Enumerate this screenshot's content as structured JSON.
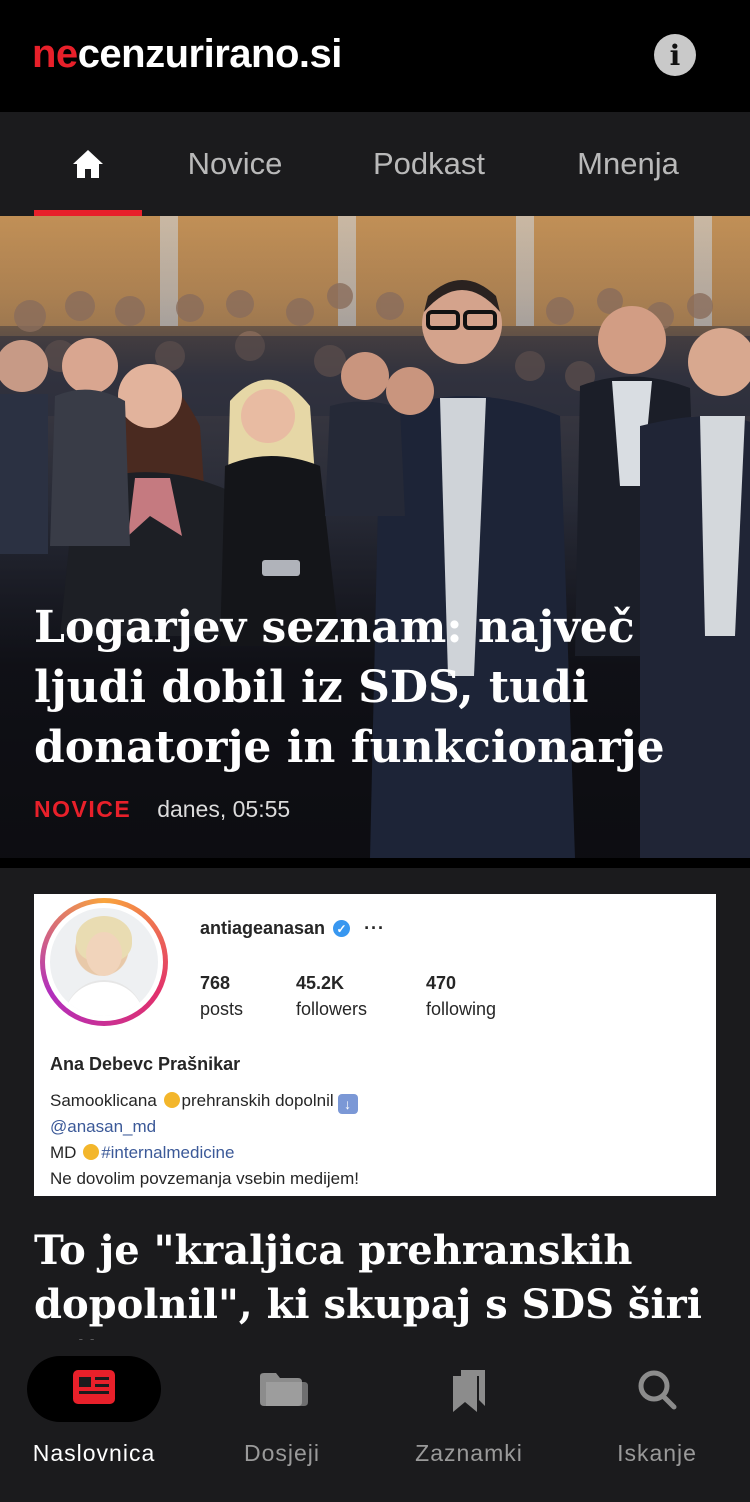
{
  "header": {
    "logo_prefix": "ne",
    "logo_rest": "cenzurirano.si",
    "info_icon": "info-icon",
    "info_symbol": "i"
  },
  "nav": {
    "tabs": [
      {
        "label": "",
        "icon": "home-icon",
        "active": true
      },
      {
        "label": "Novice"
      },
      {
        "label": "Podkast"
      },
      {
        "label": "Mnenja"
      }
    ]
  },
  "hero": {
    "title": "Logarjev seznam: največ ljudi dobil iz SDS, tudi donatorje in funkcionarje",
    "category": "NOVICE",
    "time": "danes, 05:55"
  },
  "article2": {
    "image": {
      "username": "antiageanasan",
      "more": "···",
      "stats": [
        {
          "num": "768",
          "label": "posts"
        },
        {
          "num": "45.2K",
          "label": "followers"
        },
        {
          "num": "470",
          "label": "following"
        }
      ],
      "name": "Ana Debevc Prašnikar",
      "bio_line1_a": "Samooklicana",
      "bio_line1_b": "prehranskih dopolnil",
      "bio_line2": "@anasan_md",
      "bio_line3_a": "MD",
      "bio_line3_b": "#internalmedicine",
      "bio_line4": "Ne dovolim povzemanja vsebin medijem!"
    },
    "title": "To je \"kraljica prehranskih dopolnil\", ki skupaj s SDS širi laži"
  },
  "bottom_nav": {
    "items": [
      {
        "label": "Naslovnica",
        "icon": "news-icon",
        "active": true
      },
      {
        "label": "Dosjeji",
        "icon": "folder-icon"
      },
      {
        "label": "Zaznamki",
        "icon": "bookmarks-icon"
      },
      {
        "label": "Iskanje",
        "icon": "search-icon"
      }
    ]
  },
  "colors": {
    "accent": "#e8202a",
    "background": "#000000",
    "panel": "#1b1b1d"
  }
}
